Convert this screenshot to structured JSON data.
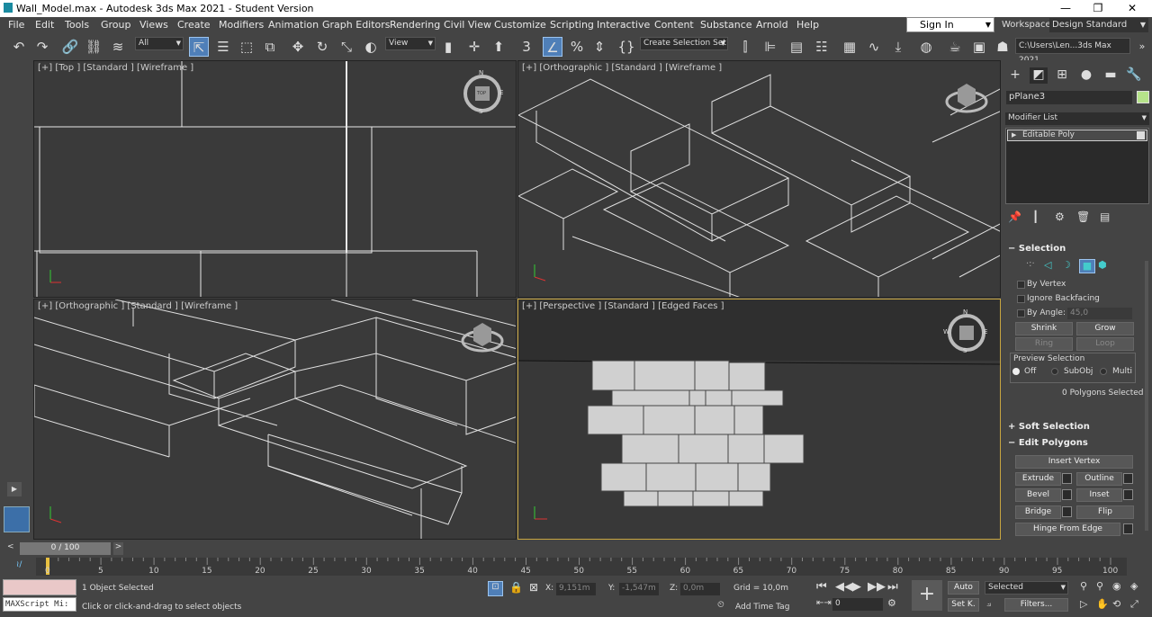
{
  "window": {
    "title": "Wall_Model.max - Autodesk 3ds Max 2021 - Student Version",
    "minimize": "—",
    "restore": "❐",
    "close": "✕"
  },
  "menu": [
    "File",
    "Edit",
    "Tools",
    "Group",
    "Views",
    "Create",
    "Modifiers",
    "Animation",
    "Graph Editors",
    "Rendering",
    "Civil View",
    "Customize",
    "Scripting",
    "Interactive",
    "Content",
    "Substance",
    "Arnold",
    "Help"
  ],
  "signin": "Sign In",
  "workspaces": {
    "label": "Workspaces:",
    "value": "Design Standard"
  },
  "toolbar": {
    "filter": "All",
    "refcoord": "View",
    "selection_set": "Create Selection Set",
    "path": "C:\\Users\\Len...3ds Max 2021"
  },
  "viewports": {
    "top": "[+] [Top ] [Standard ] [Wireframe ]",
    "ortho_tr": "[+] [Orthographic ] [Standard ] [Wireframe ]",
    "ortho_bl": "[+] [Orthographic ] [Standard ] [Wireframe ]",
    "persp": "[+] [Perspective ] [Standard ] [Edged Faces ]",
    "cube_label": "TOP",
    "compass": {
      "n": "N",
      "s": "S",
      "e": "E",
      "w": "W"
    }
  },
  "command_panel": {
    "object_name": "pPlane3",
    "object_color": "#b6e38a",
    "modifier_list": "Modifier List",
    "stack_item": "Editable Poly",
    "selection": {
      "header": "Selection",
      "by_vertex": "By Vertex",
      "ignore_backfacing": "Ignore Backfacing",
      "by_angle": "By Angle:",
      "angle_value": "45,0",
      "shrink": "Shrink",
      "grow": "Grow",
      "ring": "Ring",
      "loop": "Loop",
      "preview_label": "Preview Selection",
      "off": "Off",
      "subobj": "SubObj",
      "multi": "Multi",
      "status": "0 Polygons Selected"
    },
    "soft_selection": "Soft Selection",
    "edit_polygons": {
      "header": "Edit Polygons",
      "insert_vertex": "Insert Vertex",
      "extrude": "Extrude",
      "outline": "Outline",
      "bevel": "Bevel",
      "inset": "Inset",
      "bridge": "Bridge",
      "flip": "Flip",
      "hinge": "Hinge From Edge"
    }
  },
  "timeline": {
    "frame_display": "0 / 100",
    "ticks": [
      "0",
      "5",
      "10",
      "15",
      "20",
      "25",
      "30",
      "35",
      "40",
      "45",
      "50",
      "55",
      "60",
      "65",
      "70",
      "75",
      "80",
      "85",
      "90",
      "95",
      "100"
    ]
  },
  "status": {
    "maxscript": "MAXScript Mi:",
    "objects_selected": "1 Object Selected",
    "prompt": "Click or click-and-drag to select objects",
    "x_label": "X:",
    "x_value": "9,151m",
    "y_label": "Y:",
    "y_value": "-1,547m",
    "z_label": "Z:",
    "z_value": "0,0m",
    "grid": "Grid = 10,0m",
    "add_time_tag": "Add Time Tag",
    "auto": "Auto",
    "set_key": "Set K.",
    "selected": "Selected",
    "filters": "Filters...",
    "frame": "0"
  }
}
